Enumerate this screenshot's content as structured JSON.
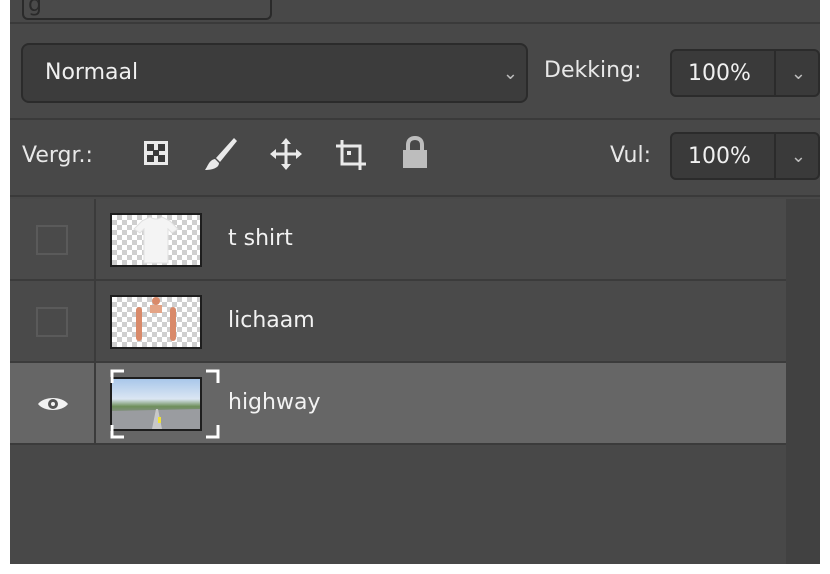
{
  "top": {
    "partial_label": "g"
  },
  "blend": {
    "value": "Normaal"
  },
  "opacity": {
    "label": "Dekking:",
    "value": "100%"
  },
  "lock": {
    "label": "Vergr.:",
    "icons": [
      "lock-transparent-pixels-icon",
      "lock-image-pixels-icon",
      "lock-position-icon",
      "lock-artboard-icon",
      "lock-all-icon"
    ]
  },
  "fill": {
    "label": "Vul:",
    "value": "100%"
  },
  "layers": [
    {
      "name": "t shirt",
      "visible": false,
      "thumbnail": "tshirt-thumbnail",
      "selected": false
    },
    {
      "name": "lichaam",
      "visible": false,
      "thumbnail": "body-thumbnail",
      "selected": false
    },
    {
      "name": "highway",
      "visible": true,
      "thumbnail": "highway-thumbnail",
      "selected": true
    }
  ],
  "colors": {
    "panel": "#484848",
    "selected_row": "#666666",
    "field_bg": "#3a3a3a",
    "text": "#f0f0f0"
  }
}
